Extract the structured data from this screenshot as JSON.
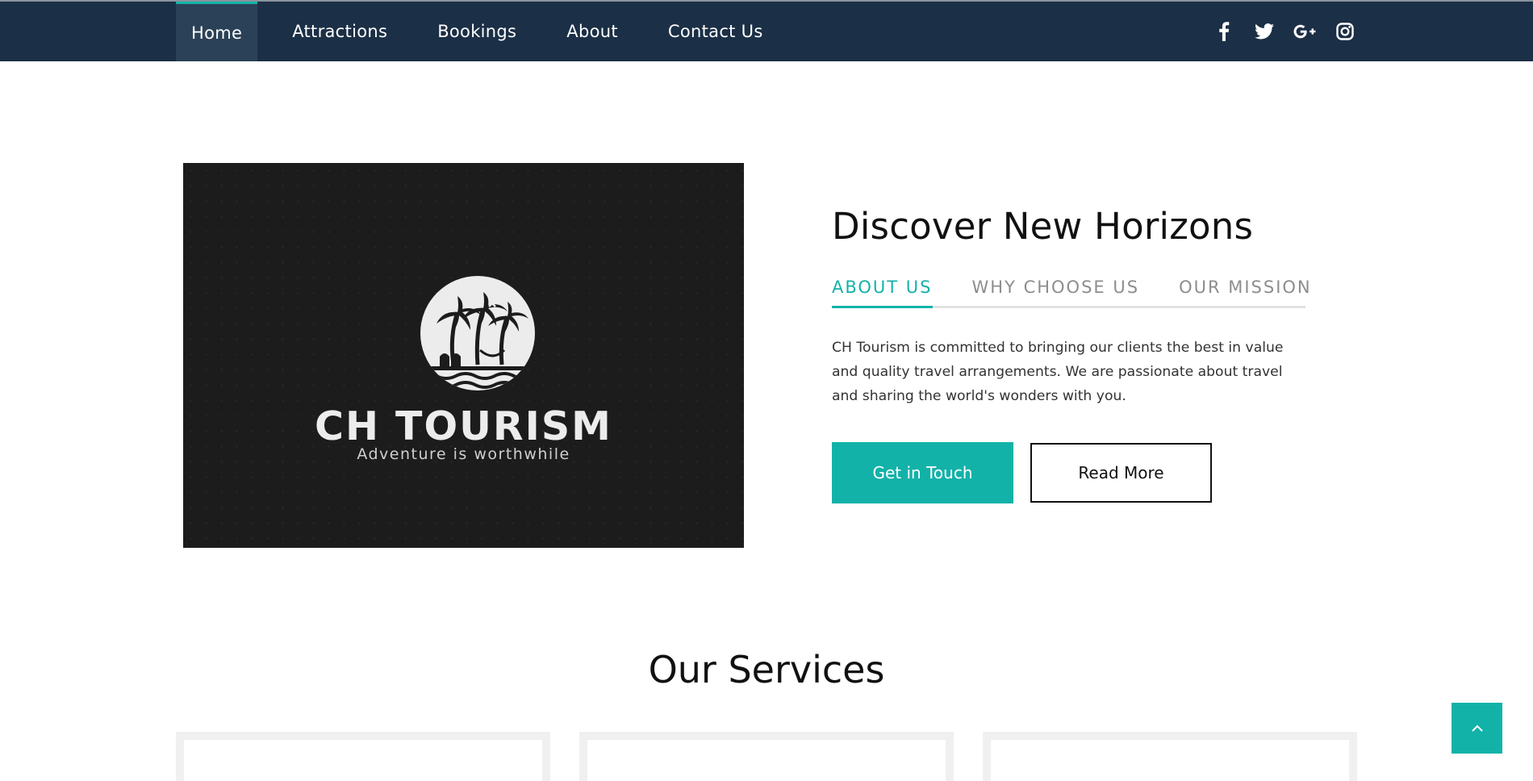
{
  "nav": {
    "items": [
      {
        "label": "Home",
        "active": true
      },
      {
        "label": "Attractions",
        "active": false
      },
      {
        "label": "Bookings",
        "active": false
      },
      {
        "label": "About",
        "active": false
      },
      {
        "label": "Contact Us",
        "active": false
      }
    ],
    "social": [
      "facebook-icon",
      "twitter-icon",
      "google-plus-icon",
      "instagram-icon"
    ],
    "background": "#1b2f46",
    "active_background": "#2b4158"
  },
  "hero": {
    "logo_title": "CH TOURISM",
    "logo_tagline": "Adventure is worthwhile",
    "heading": "Discover New Horizons",
    "tabs": [
      {
        "label": "ABOUT US",
        "active": true
      },
      {
        "label": "WHY CHOOSE US",
        "active": false
      },
      {
        "label": "OUR MISSION",
        "active": false
      }
    ],
    "paragraph": "CH Tourism is committed to bringing our clients the best in value and quality travel arrangements. We are passionate about travel and sharing the world's wonders with you.",
    "primary_button": "Get in Touch",
    "secondary_button": "Read More"
  },
  "services": {
    "title": "Our Services"
  },
  "colors": {
    "accent": "#13b2a8",
    "text": "#111111"
  },
  "icons": {
    "back_to_top": "chevron-up-icon"
  }
}
